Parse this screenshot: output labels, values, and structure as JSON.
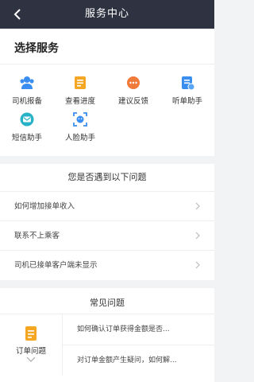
{
  "header": {
    "title": "服务中心"
  },
  "services": {
    "title": "选择服务",
    "items": [
      {
        "label": "司机报备",
        "icon": "driver-report-icon"
      },
      {
        "label": "查看进度",
        "icon": "progress-icon"
      },
      {
        "label": "建议反馈",
        "icon": "feedback-icon"
      },
      {
        "label": "听单助手",
        "icon": "order-assistant-icon"
      },
      {
        "label": "短信助手",
        "icon": "sms-assistant-icon"
      },
      {
        "label": "人脸助手",
        "icon": "face-assistant-icon"
      }
    ]
  },
  "problems": {
    "title": "您是否遇到以下问题",
    "items": [
      {
        "text": "如何增加接单收入"
      },
      {
        "text": "联系不上乘客"
      },
      {
        "text": "司机已接单客户端未显示"
      }
    ]
  },
  "faq": {
    "title": "常见问题",
    "category": "订单问题",
    "questions": [
      {
        "text": "如何确认订单获得金额是否..."
      },
      {
        "text": "对订单金额产生疑问，如何解..."
      }
    ]
  },
  "colors": {
    "header_bg": "#2f3240",
    "blue": "#3a8ef0",
    "orange": "#f5a623",
    "orange_red": "#f07a3a",
    "teal": "#27b2c8"
  }
}
